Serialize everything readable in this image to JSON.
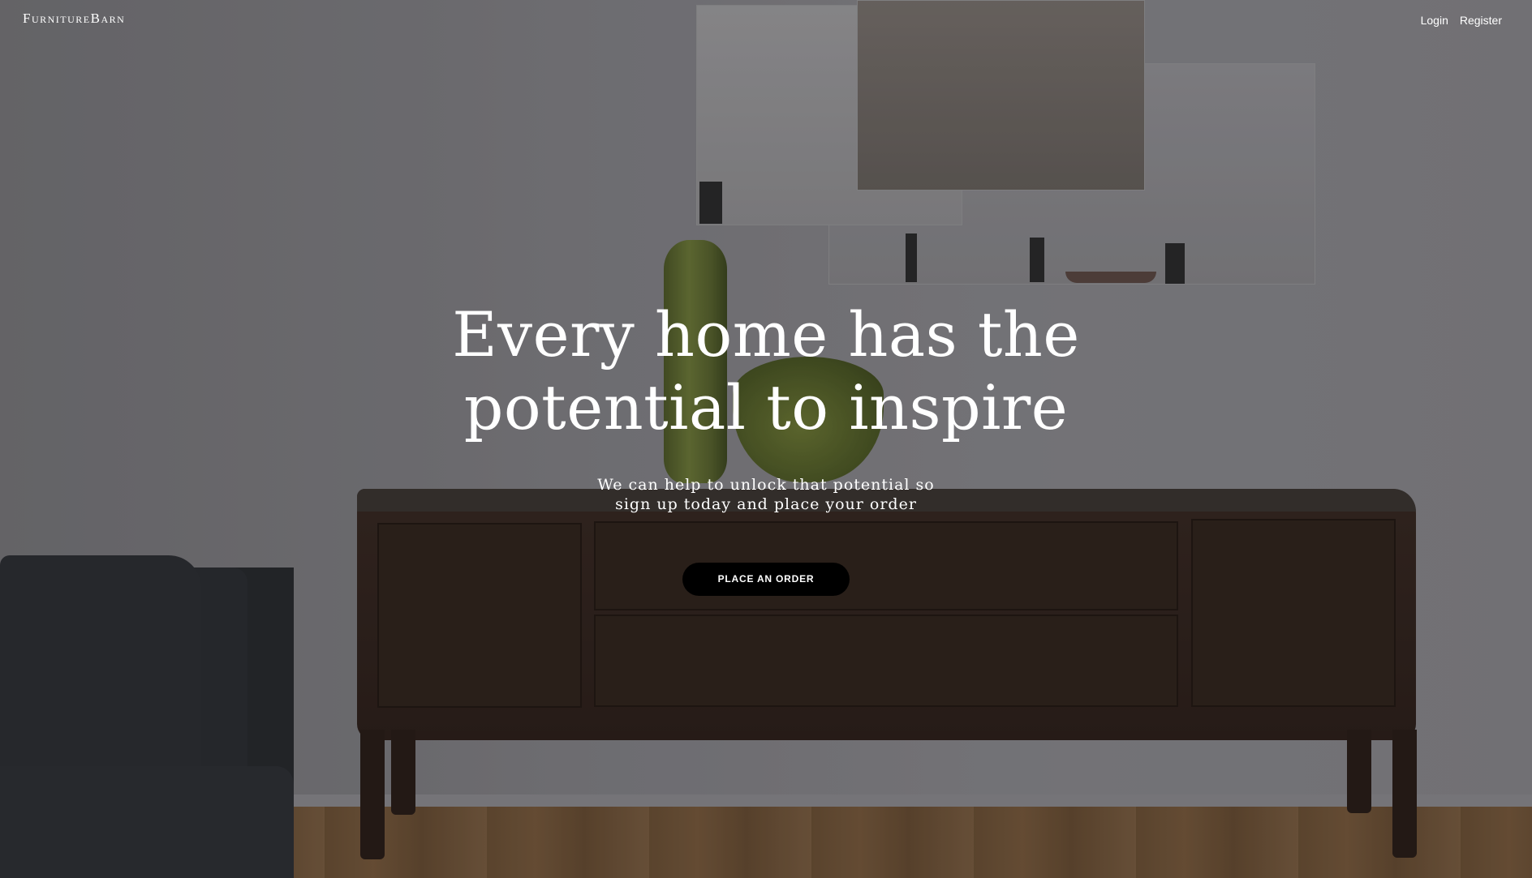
{
  "header": {
    "brand": "FurnitureBarn",
    "nav": {
      "login": "Login",
      "register": "Register"
    }
  },
  "hero": {
    "title_line1": "Every home has the",
    "title_line2": "potential to inspire",
    "subtitle_line1": "We can help to unlock that potential so",
    "subtitle_line2": "sign up today and place your order",
    "cta_label": "PLACE AN ORDER"
  },
  "colors": {
    "text": "#ffffff",
    "button_bg": "#000000"
  }
}
